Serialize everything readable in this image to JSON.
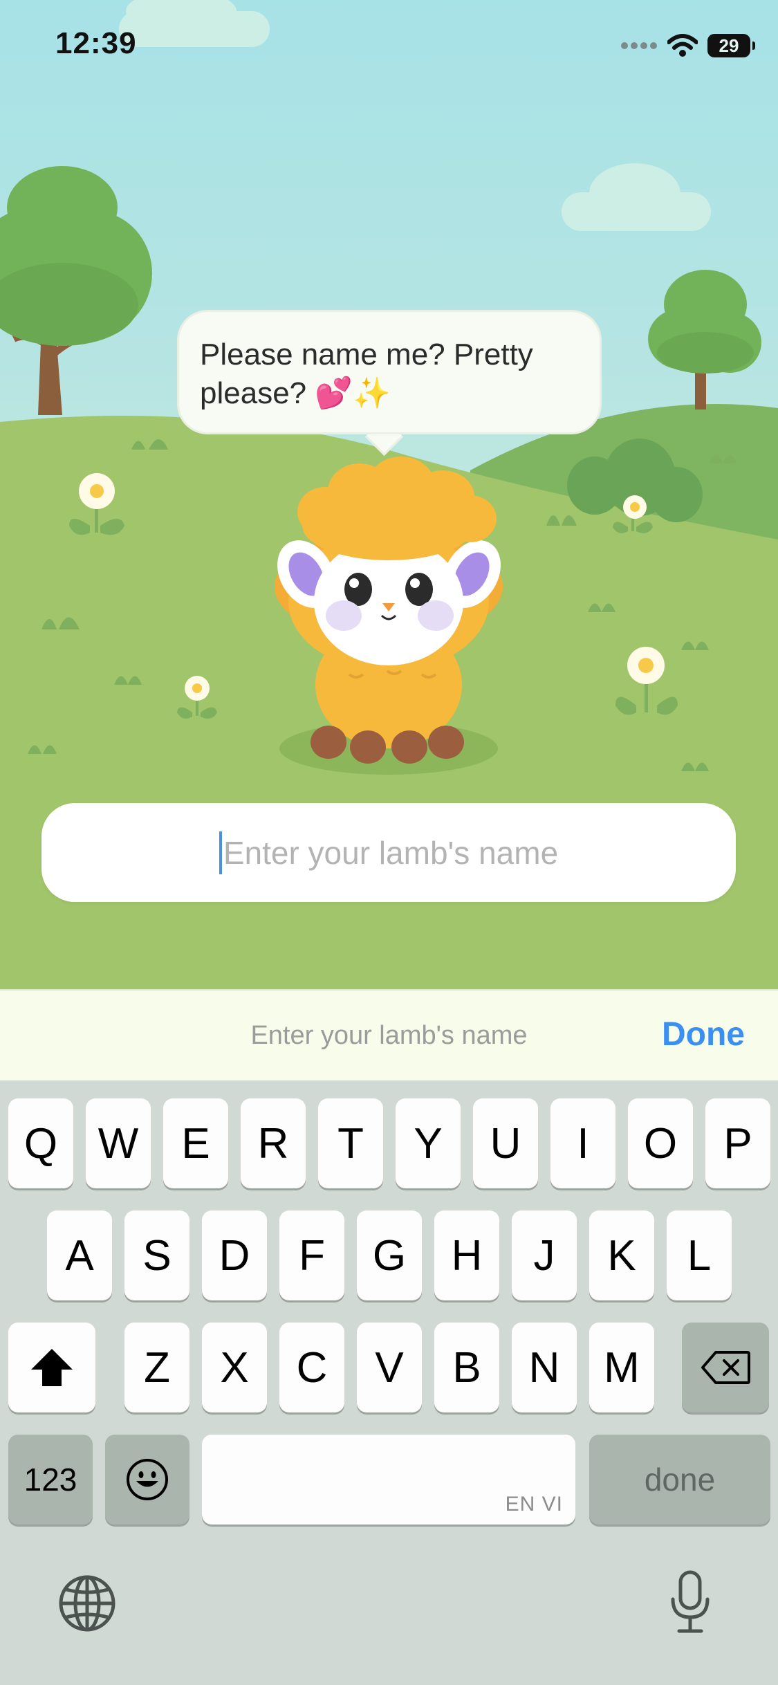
{
  "status_bar": {
    "time": "12:39",
    "battery": "29",
    "icons": [
      "signal-icon",
      "wifi-icon",
      "battery-icon"
    ]
  },
  "bubble": {
    "text": "Please name me? Pretty please? 💕✨"
  },
  "name_input": {
    "placeholder": "Enter your lamb's name"
  },
  "accessory": {
    "placeholder": "Enter your lamb's name",
    "done_label": "Done"
  },
  "keyboard": {
    "row1": [
      "Q",
      "W",
      "E",
      "R",
      "T",
      "Y",
      "U",
      "I",
      "O",
      "P"
    ],
    "row2": [
      "A",
      "S",
      "D",
      "F",
      "G",
      "H",
      "J",
      "K",
      "L"
    ],
    "row3": [
      "Z",
      "X",
      "C",
      "V",
      "B",
      "N",
      "M"
    ],
    "numbers_label": "123",
    "space_languages": "EN VI",
    "return_label": "done"
  },
  "colors": {
    "sky": "#a7e2e6",
    "grass": "#a1c56b",
    "lamb_wool": "#f6b93c",
    "accent": "#3b8ff0"
  }
}
